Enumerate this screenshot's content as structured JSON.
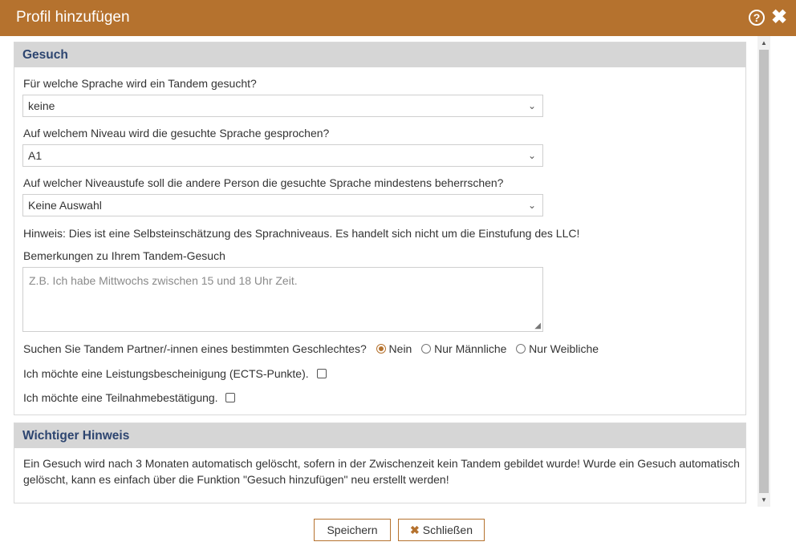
{
  "dialog": {
    "title": "Profil hinzufügen",
    "help_glyph": "?",
    "close_glyph": "✖"
  },
  "gesuch": {
    "heading": "Gesuch",
    "language_label": "Für welche Sprache wird ein Tandem gesucht?",
    "language_value": "keine",
    "level_label": "Auf welchem Niveau wird die gesuchte Sprache gesprochen?",
    "level_value": "A1",
    "min_level_label": "Auf welcher Niveaustufe soll die andere Person die gesuchte Sprache mindestens beherrschen?",
    "min_level_value": "Keine Auswahl",
    "hint": "Hinweis: Dies ist eine Selbsteinschätzung des Sprachniveaus. Es handelt sich nicht um die Einstufung des LLC!",
    "remarks_label": "Bemerkungen zu Ihrem Tandem-Gesuch",
    "remarks_placeholder": "Z.B. Ich habe Mittwochs zwischen 15 und 18 Uhr Zeit.",
    "gender_label": "Suchen Sie Tandem Partner/-innen eines bestimmten Geschlechtes?",
    "gender_options": [
      "Nein",
      "Nur Männliche",
      "Nur Weibliche"
    ],
    "gender_selected": "Nein",
    "ects_label": "Ich möchte eine Leistungsbescheinigung (ECTS-Punkte).",
    "participation_label": "Ich möchte eine Teilnahmebestätigung."
  },
  "notice": {
    "heading": "Wichtiger Hinweis",
    "line1": "Ein Gesuch wird nach 3 Monaten automatisch gelöscht, sofern in der Zwischenzeit kein Tandem gebildet wurde! Wurde ein Gesuch automatisch",
    "line2": "gelöscht, kann es einfach über die Funktion \"Gesuch hinzufügen\" neu erstellt werden!"
  },
  "buttons": {
    "save": "Speichern",
    "close": "Schließen",
    "close_icon_glyph": "✖"
  },
  "colors": {
    "accent": "#b5722e",
    "heading_text": "#2d4570",
    "panel_header_bg": "#d6d6d6"
  }
}
